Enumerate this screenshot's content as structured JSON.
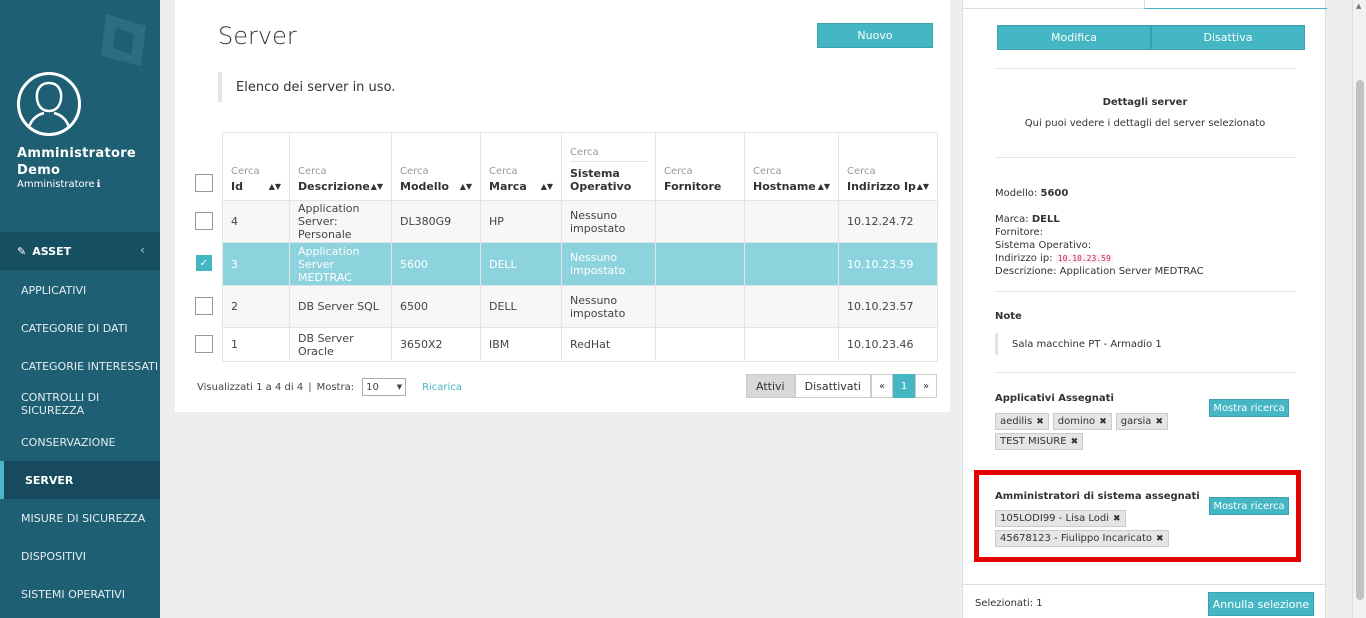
{
  "sidebar": {
    "user_name": "Amministratore Demo",
    "user_role": "Amministratore",
    "role_info_icon": "info-icon",
    "section_label": "ASSET",
    "items": [
      {
        "label": "APPLICATIVI"
      },
      {
        "label": "CATEGORIE DI DATI"
      },
      {
        "label": "CATEGORIE INTERESSATI"
      },
      {
        "label": "CONTROLLI DI SICUREZZA"
      },
      {
        "label": "CONSERVAZIONE"
      },
      {
        "label": "SERVER",
        "active": true
      },
      {
        "label": "MISURE DI SICUREZZA"
      },
      {
        "label": "DISPOSITIVI"
      },
      {
        "label": "SISTEMI OPERATIVI"
      }
    ]
  },
  "main": {
    "title": "Server",
    "new_button": "Nuovo",
    "intro": "Elenco dei server in uso.",
    "search_label": "Cerca",
    "columns": [
      "Id",
      "Descrizione",
      "Modello",
      "Marca",
      "Sistema Operativo",
      "Fornitore",
      "Hostname",
      "Indirizzo Ip"
    ],
    "rows": [
      {
        "id": "4",
        "descrizione": "Application Server: Personale",
        "modello": "DL380G9",
        "marca": "HP",
        "so": "Nessuno impostato",
        "fornitore": "",
        "hostname": "",
        "ip": "10.12.24.72",
        "checked": false
      },
      {
        "id": "3",
        "descrizione": "Application Server MEDTRAC",
        "modello": "5600",
        "marca": "DELL",
        "so": "Nessuno impostato",
        "fornitore": "",
        "hostname": "",
        "ip": "10.10.23.59",
        "checked": true
      },
      {
        "id": "2",
        "descrizione": "DB Server SQL",
        "modello": "6500",
        "marca": "DELL",
        "so": "Nessuno impostato",
        "fornitore": "",
        "hostname": "",
        "ip": "10.10.23.57",
        "checked": false
      },
      {
        "id": "1",
        "descrizione": "DB Server Oracle",
        "modello": "3650X2",
        "marca": "IBM",
        "so": "RedHat",
        "fornitore": "",
        "hostname": "",
        "ip": "10.10.23.46",
        "checked": false
      }
    ],
    "footer": {
      "info": "Visualizzati 1 a 4 di 4",
      "separator": "|",
      "show_label": "Mostra:",
      "page_size": "10",
      "reload": "Ricarica",
      "active": "Attivi",
      "inactive": "Disattivati",
      "prev": "«",
      "page": "1",
      "next": "»"
    }
  },
  "panel": {
    "edit": "Modifica",
    "deactivate": "Disattiva",
    "details_title": "Dettagli server",
    "details_sub": "Qui puoi vedere i dettagli del server selezionato",
    "model_label": "Modello:",
    "model_value": "5600",
    "brand_label": "Marca:",
    "brand_value": "DELL",
    "supplier_label": "Fornitore:",
    "os_label": "Sistema Operativo:",
    "ip_label": "Indirizzo ip:",
    "ip_value": "10.10.23.59",
    "desc_label": "Descrizione:",
    "desc_value": "Application Server MEDTRAC",
    "notes_title": "Note",
    "notes_text": "Sala macchine PT - Armadio 1",
    "apps_title": "Applicativi Assegnati",
    "apps_button": "Mostra ricerca",
    "apps_tags": [
      "aedilis",
      "domino",
      "garsia",
      "TEST MISURE"
    ],
    "admins_title": "Amministratori di sistema assegnati",
    "admins_button": "Mostra ricerca",
    "admins_tags": [
      "105LODI99 - Lisa Lodi",
      "45678123 - Fiulippo Incaricato"
    ],
    "tag_remove_icon": "✖",
    "selected_label": "Selezionati: 1",
    "cancel_selection": "Annulla selezione"
  },
  "colors": {
    "sidebar": "#1f5f74",
    "accent": "#45b7c4",
    "highlight": "#e60000",
    "selected_row": "#8dd3dd"
  }
}
